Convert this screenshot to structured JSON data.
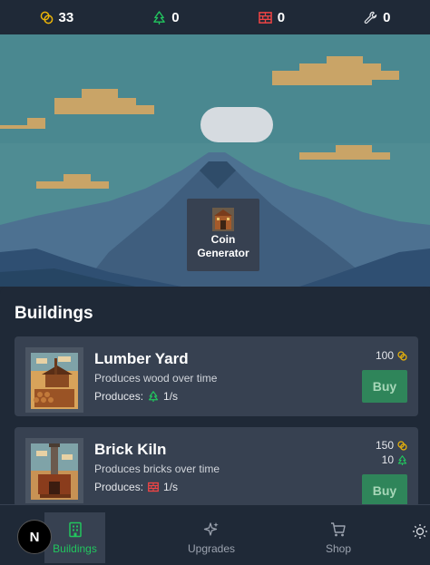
{
  "resources": [
    {
      "name": "coins",
      "icon": "coins-icon",
      "value": "33",
      "color": "#eab308"
    },
    {
      "name": "wood",
      "icon": "tree-icon",
      "value": "0",
      "color": "#22c55e"
    },
    {
      "name": "bricks",
      "icon": "brick-icon",
      "value": "0",
      "color": "#ef4444"
    },
    {
      "name": "tools",
      "icon": "wrench-icon",
      "value": "0",
      "color": "#e5e7eb"
    }
  ],
  "scene": {
    "coin_generator_label": "Coin Generator"
  },
  "buildings": {
    "title": "Buildings",
    "items": [
      {
        "name": "Lumber Yard",
        "description": "Produces wood over time",
        "produces_label": "Produces:",
        "produces_icon": "tree-icon",
        "rate": "1/s",
        "costs": [
          {
            "amount": "100",
            "icon": "coins-icon"
          }
        ],
        "buy_label": "Buy"
      },
      {
        "name": "Brick Kiln",
        "description": "Produces bricks over time",
        "produces_label": "Produces:",
        "produces_icon": "brick-icon",
        "rate": "1/s",
        "costs": [
          {
            "amount": "150",
            "icon": "coins-icon"
          },
          {
            "amount": "10",
            "icon": "tree-icon"
          }
        ],
        "buy_label": "Buy"
      }
    ]
  },
  "nav": {
    "items": [
      {
        "label": "Buildings",
        "icon": "building-icon",
        "active": true
      },
      {
        "label": "Upgrades",
        "icon": "sparkles-icon",
        "active": false
      },
      {
        "label": "Shop",
        "icon": "cart-icon",
        "active": false
      },
      {
        "label": "",
        "icon": "sun-icon",
        "active": false
      }
    ],
    "logo_letter": "N"
  }
}
